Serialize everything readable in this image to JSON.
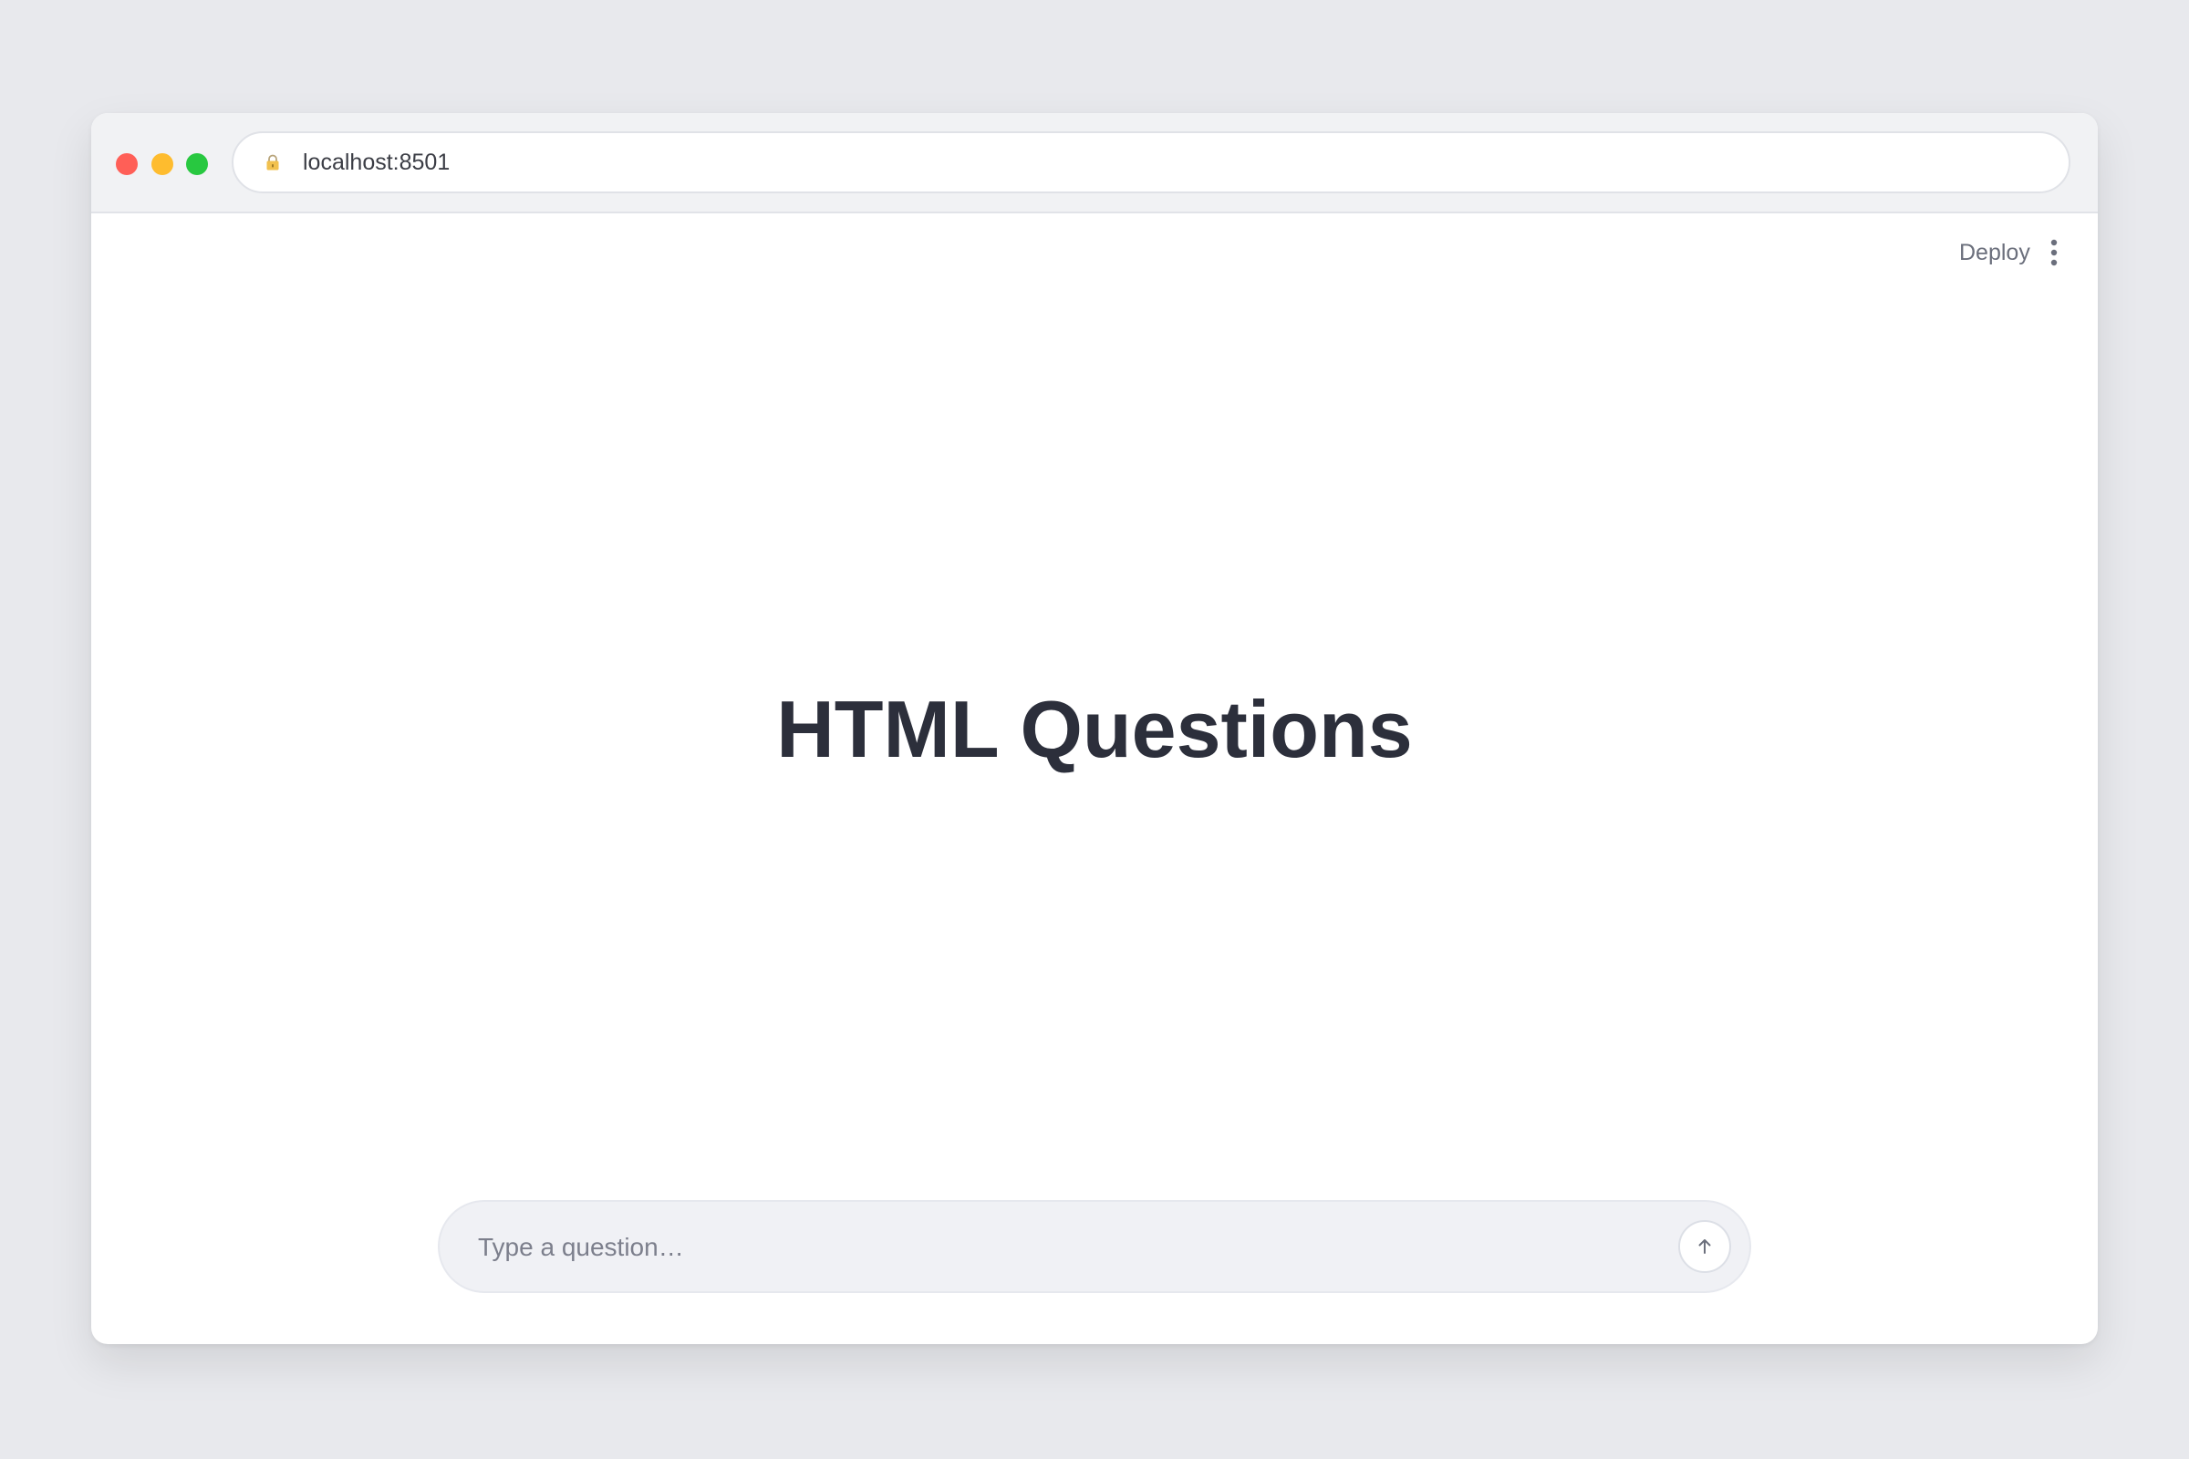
{
  "browser": {
    "url": "localhost:8501",
    "traffic_lights": {
      "close": "#ff5f57",
      "minimize": "#febc2e",
      "maximize": "#28c840"
    }
  },
  "toolbar": {
    "deploy_label": "Deploy",
    "menu_icon": "kebab-menu-icon"
  },
  "main": {
    "title": "HTML Questions"
  },
  "chat": {
    "placeholder": "Type a question…",
    "value": "",
    "send_icon": "arrow-up-icon"
  },
  "colors": {
    "background": "#e8e9ed",
    "title": "#2c2f3b",
    "input_background": "#f0f1f5"
  }
}
